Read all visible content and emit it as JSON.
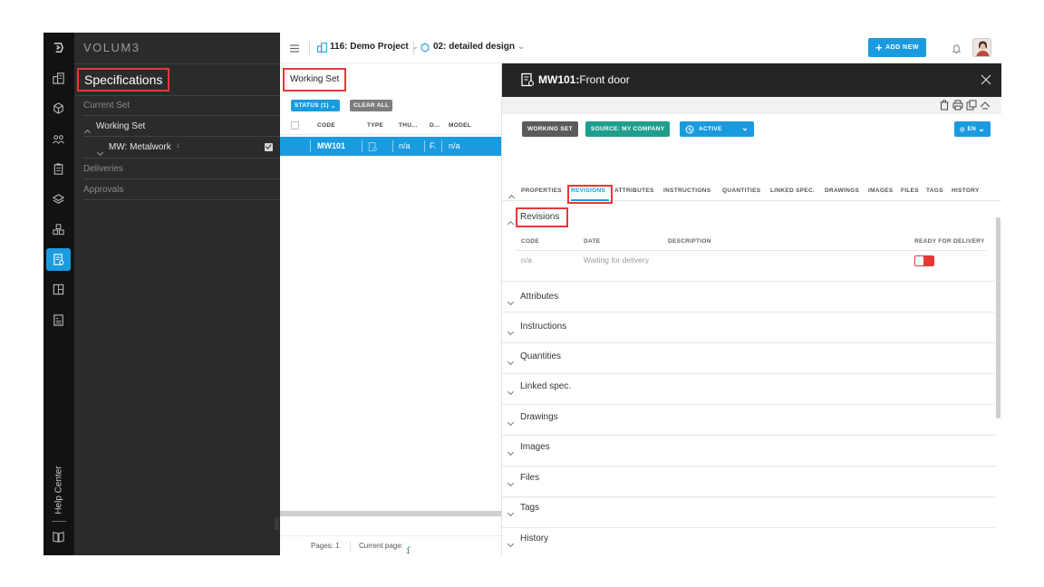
{
  "brand": "VOLUM3",
  "left_panel": {
    "title": "Specifications",
    "current_set": "Current Set",
    "working_set": "Working Set",
    "metalwork": "MW: Metalwork",
    "metalwork_count": "1",
    "deliveries": "Deliveries",
    "approvals": "Approvals"
  },
  "rail": {
    "help_center": "Help Center",
    "icons": [
      "logo-icon",
      "buildings-icon",
      "model-icon",
      "users-icon",
      "clipboard-icon",
      "layers-icon",
      "cubes-icon",
      "specifications-icon",
      "layout-icon",
      "document-icon",
      "book-icon"
    ]
  },
  "header": {
    "project": "116: Demo Project",
    "design": "02: detailed design",
    "add_new": "ADD NEW"
  },
  "middle": {
    "working_set_label": "Working Set",
    "status_filter": "STATUS (1)",
    "clear_all": "CLEAR ALL",
    "columns": [
      "CODE",
      "TYPE",
      "THU...",
      "D...",
      "MODEL"
    ],
    "row": {
      "code": "MW101",
      "thumb": "n/a",
      "d": "F.",
      "model": "n/a"
    },
    "pages": "Pages: 1",
    "current_page_label": "Current page:",
    "current_page_value": "1"
  },
  "detail": {
    "code": "MW101:",
    "name": "Front door",
    "pill_working_set": "WORKING SET",
    "pill_source": "SOURCE: MY COMPANY",
    "pill_status": "ACTIVE",
    "pill_lang": "EN",
    "tabs": [
      "PROPERTIES",
      "REVISIONS",
      "ATTRIBUTES",
      "INSTRUCTIONS",
      "QUANTITIES",
      "LINKED SPEC.",
      "DRAWINGS",
      "IMAGES",
      "FILES",
      "TAGS",
      "HISTORY"
    ],
    "revisions": {
      "title": "Revisions",
      "col_code": "CODE",
      "col_date": "DATE",
      "col_description": "DESCRIPTION",
      "col_ready": "READY FOR DELIVERY",
      "row_code": "n/a",
      "row_date": "Waiting for delivery"
    },
    "sections": [
      "Attributes",
      "Instructions",
      "Quantities",
      "Linked spec.",
      "Drawings",
      "Images",
      "Files",
      "Tags",
      "History"
    ]
  },
  "colors": {
    "accent": "#1a9be0",
    "highlight_box": "#e53935",
    "source_green": "#1f9e8e",
    "dark_bg": "#2b2b2b"
  }
}
